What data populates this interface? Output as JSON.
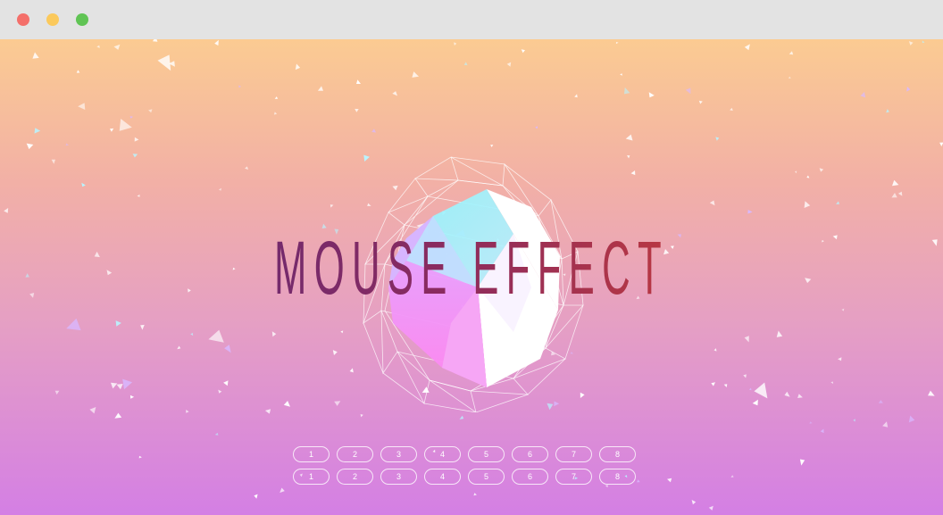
{
  "title": "MOUSE EFFECT",
  "button_rows": [
    {
      "buttons": [
        "1",
        "2",
        "3",
        "4",
        "5",
        "6",
        "7",
        "8"
      ]
    },
    {
      "buttons": [
        "1",
        "2",
        "3",
        "4",
        "5",
        "6",
        "7",
        "8"
      ]
    }
  ],
  "colors": {
    "gradient_top": "#fbcb92",
    "gradient_bottom": "#d47fe4",
    "title_start": "#6e2a70",
    "title_end": "#c23a3c"
  },
  "icons": [
    "close-dot",
    "minimize-dot",
    "maximize-dot"
  ]
}
